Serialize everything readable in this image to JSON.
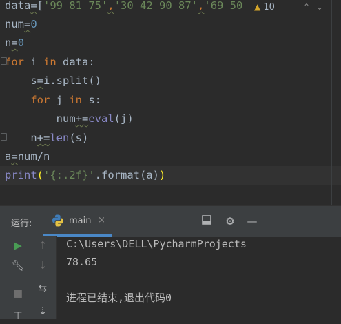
{
  "editor": {
    "lines": [
      {
        "id": "l1",
        "parts": [
          {
            "t": "data",
            "c": "m"
          },
          {
            "t": "=",
            "c": "m wv"
          },
          {
            "t": "[",
            "c": "m"
          },
          {
            "t": "'99 81 75'",
            "c": "s"
          },
          {
            "t": ",",
            "c": "k wv"
          },
          {
            "t": "'30 42 90 87'",
            "c": "s"
          },
          {
            "t": ",",
            "c": "k wv"
          },
          {
            "t": "'69 50 '",
            "c": "s"
          }
        ]
      },
      {
        "id": "l2",
        "parts": [
          {
            "t": "num",
            "c": "m"
          },
          {
            "t": "=",
            "c": "m wv"
          },
          {
            "t": "0",
            "c": "n"
          }
        ]
      },
      {
        "id": "l3",
        "parts": [
          {
            "t": "n",
            "c": "m"
          },
          {
            "t": "=",
            "c": "m wv"
          },
          {
            "t": "0",
            "c": "n"
          }
        ]
      },
      {
        "id": "l4",
        "parts": [
          {
            "t": "for",
            "c": "k"
          },
          {
            "t": " i ",
            "c": "m"
          },
          {
            "t": "in",
            "c": "k"
          },
          {
            "t": " data:",
            "c": "m"
          }
        ]
      },
      {
        "id": "l5",
        "parts": [
          {
            "t": "    s",
            "c": "m"
          },
          {
            "t": "=",
            "c": "m wv"
          },
          {
            "t": "i.split()",
            "c": "m"
          }
        ]
      },
      {
        "id": "l6",
        "parts": [
          {
            "t": "    ",
            "c": "m"
          },
          {
            "t": "for",
            "c": "k"
          },
          {
            "t": " j ",
            "c": "m"
          },
          {
            "t": "in",
            "c": "k"
          },
          {
            "t": " s:",
            "c": "m"
          }
        ]
      },
      {
        "id": "l7",
        "parts": [
          {
            "t": "        num",
            "c": "m"
          },
          {
            "t": "+=",
            "c": "m wv"
          },
          {
            "t": "eval",
            "c": "bi"
          },
          {
            "t": "(j)",
            "c": "m"
          }
        ]
      },
      {
        "id": "l8",
        "parts": [
          {
            "t": "    n",
            "c": "m"
          },
          {
            "t": "+=",
            "c": "m wv"
          },
          {
            "t": "len",
            "c": "bi"
          },
          {
            "t": "(s)",
            "c": "m"
          }
        ]
      },
      {
        "id": "l9",
        "parts": [
          {
            "t": "a",
            "c": "m"
          },
          {
            "t": "=",
            "c": "m wv"
          },
          {
            "t": "num/n",
            "c": "m"
          }
        ]
      },
      {
        "id": "l10",
        "parts": [
          {
            "t": "print",
            "c": "bi"
          },
          {
            "t": "(",
            "c": "br"
          },
          {
            "t": "'{:.2f}'",
            "c": "s"
          },
          {
            "t": ".format(a)",
            "c": "m"
          },
          {
            "t": ")",
            "c": "br"
          }
        ]
      }
    ],
    "inspection_warning_icon": "warning-triangle-icon",
    "inspection_count": "10",
    "nav_up_icon": "chevron-up-icon",
    "nav_down_icon": "chevron-down-icon"
  },
  "run_panel": {
    "title": "运行:",
    "tab_label": "main",
    "tab_icon": "python-icon",
    "tab_close": "×",
    "header_icons": [
      "layout-icon",
      "gear-icon",
      "minimize-icon"
    ],
    "toolbar_left": [
      "rerun-icon",
      "wrench-icon",
      "stop-icon",
      "pin-icon"
    ],
    "toolbar_right": [
      "arrow-up-icon",
      "arrow-down-icon",
      "soft-wrap-icon",
      "scroll-to-end-icon"
    ],
    "console": {
      "lines": [
        "C:\\Users\\DELL\\PycharmProjects",
        "78.65",
        "",
        "进程已结束,退出代码0"
      ]
    }
  },
  "colors": {
    "background": "#2b2b2b",
    "keyword": "#cc7832",
    "string": "#6a8759",
    "number": "#6897bb",
    "builtin": "#8888c6",
    "run_green": "#499c54",
    "tab_accent": "#4a88c7"
  }
}
